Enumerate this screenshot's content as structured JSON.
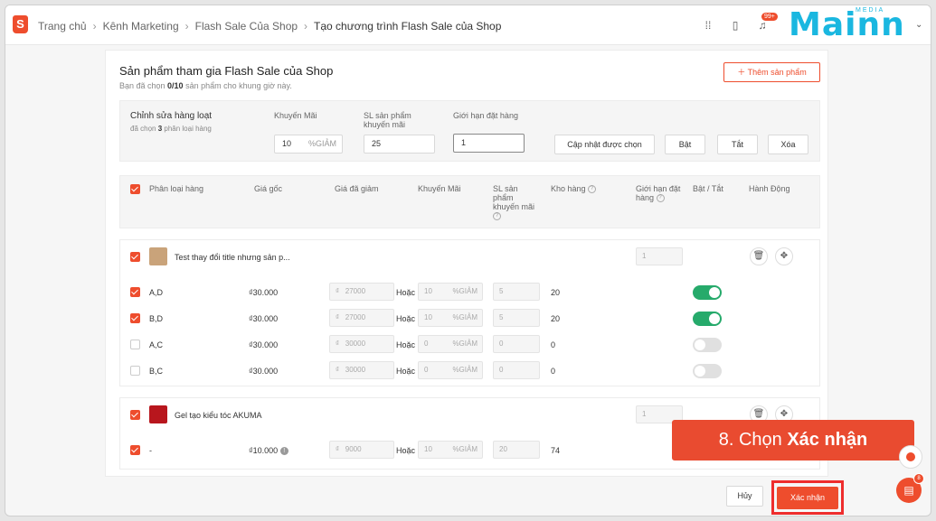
{
  "header": {
    "breadcrumb": [
      "Trang chủ",
      "Kênh Marketing",
      "Flash Sale Của Shop",
      "Tạo chương trình Flash Sale của Shop"
    ],
    "notification_badge": "99+",
    "brand_name": "Mainn",
    "brand_sub": "MEDIA"
  },
  "card": {
    "title": "Sản phẩm tham gia Flash Sale của Shop",
    "subtitle_prefix": "Bạn đã chọn ",
    "subtitle_count": "0/10",
    "subtitle_suffix": " sản phẩm cho khung giờ này.",
    "add_button": "Thêm sản phẩm"
  },
  "bulk": {
    "title": "Chỉnh sửa hàng loạt",
    "selected_prefix": "đã chọn ",
    "selected_count": "3",
    "selected_suffix": " phân loại hàng",
    "discount_label": "Khuyến Mãi",
    "discount_value": "10",
    "discount_suffix": "%GIẢM",
    "qty_label": "SL sản phẩm khuyến mãi",
    "qty_value": "25",
    "limit_label": "Giới hạn đặt hàng",
    "limit_value": "1",
    "update_button": "Cập nhật được chọn",
    "on_button": "Bật",
    "off_button": "Tắt",
    "delete_button": "Xóa"
  },
  "table_headers": {
    "variant": "Phân loại hàng",
    "original_price": "Giá gốc",
    "discounted_price": "Giá đã giảm",
    "discount": "Khuyến Mãi",
    "promo_qty": "SL sản phẩm khuyến mãi",
    "stock": "Kho hàng",
    "order_limit": "Giới hạn đặt hàng",
    "toggle": "Bật / Tắt",
    "action": "Hành Động"
  },
  "products": [
    {
      "name": "Test thay đổi title nhưng sản p...",
      "limit": "1",
      "rows": [
        {
          "variant": "A,D",
          "price": "₫30.000",
          "currency": "₫",
          "discounted": "27000",
          "or": "Hoặc",
          "percent": "10",
          "suffix": "%GIẢM",
          "qty": "5",
          "stock": "20",
          "checked": true,
          "enabled": true
        },
        {
          "variant": "B,D",
          "price": "₫30.000",
          "currency": "₫",
          "discounted": "27000",
          "or": "Hoặc",
          "percent": "10",
          "suffix": "%GIẢM",
          "qty": "5",
          "stock": "20",
          "checked": true,
          "enabled": true
        },
        {
          "variant": "A,C",
          "price": "₫30.000",
          "currency": "₫",
          "discounted": "30000",
          "or": "Hoặc",
          "percent": "0",
          "suffix": "%GIẢM",
          "qty": "0",
          "stock": "0",
          "checked": false,
          "enabled": false
        },
        {
          "variant": "B,C",
          "price": "₫30.000",
          "currency": "₫",
          "discounted": "30000",
          "or": "Hoặc",
          "percent": "0",
          "suffix": "%GIẢM",
          "qty": "0",
          "stock": "0",
          "checked": false,
          "enabled": false
        }
      ]
    },
    {
      "name": "Gel tạo kiểu tóc AKUMA",
      "limit": "1",
      "rows": [
        {
          "variant": "-",
          "price": "₫10.000",
          "currency": "₫",
          "discounted": "9000",
          "or": "Hoặc",
          "percent": "10",
          "suffix": "%GIẢM",
          "qty": "20",
          "stock": "74",
          "checked": true
        }
      ]
    }
  ],
  "footer": {
    "cancel": "Hủy",
    "confirm": "Xác nhận"
  },
  "callout": {
    "prefix": "8. Chọn ",
    "emphasis": "Xác nhận"
  },
  "chat_badge": "8",
  "colors": {
    "accent": "#ee4d2d",
    "toggle_on": "#26aa6b",
    "brand": "#1ab7e0"
  }
}
